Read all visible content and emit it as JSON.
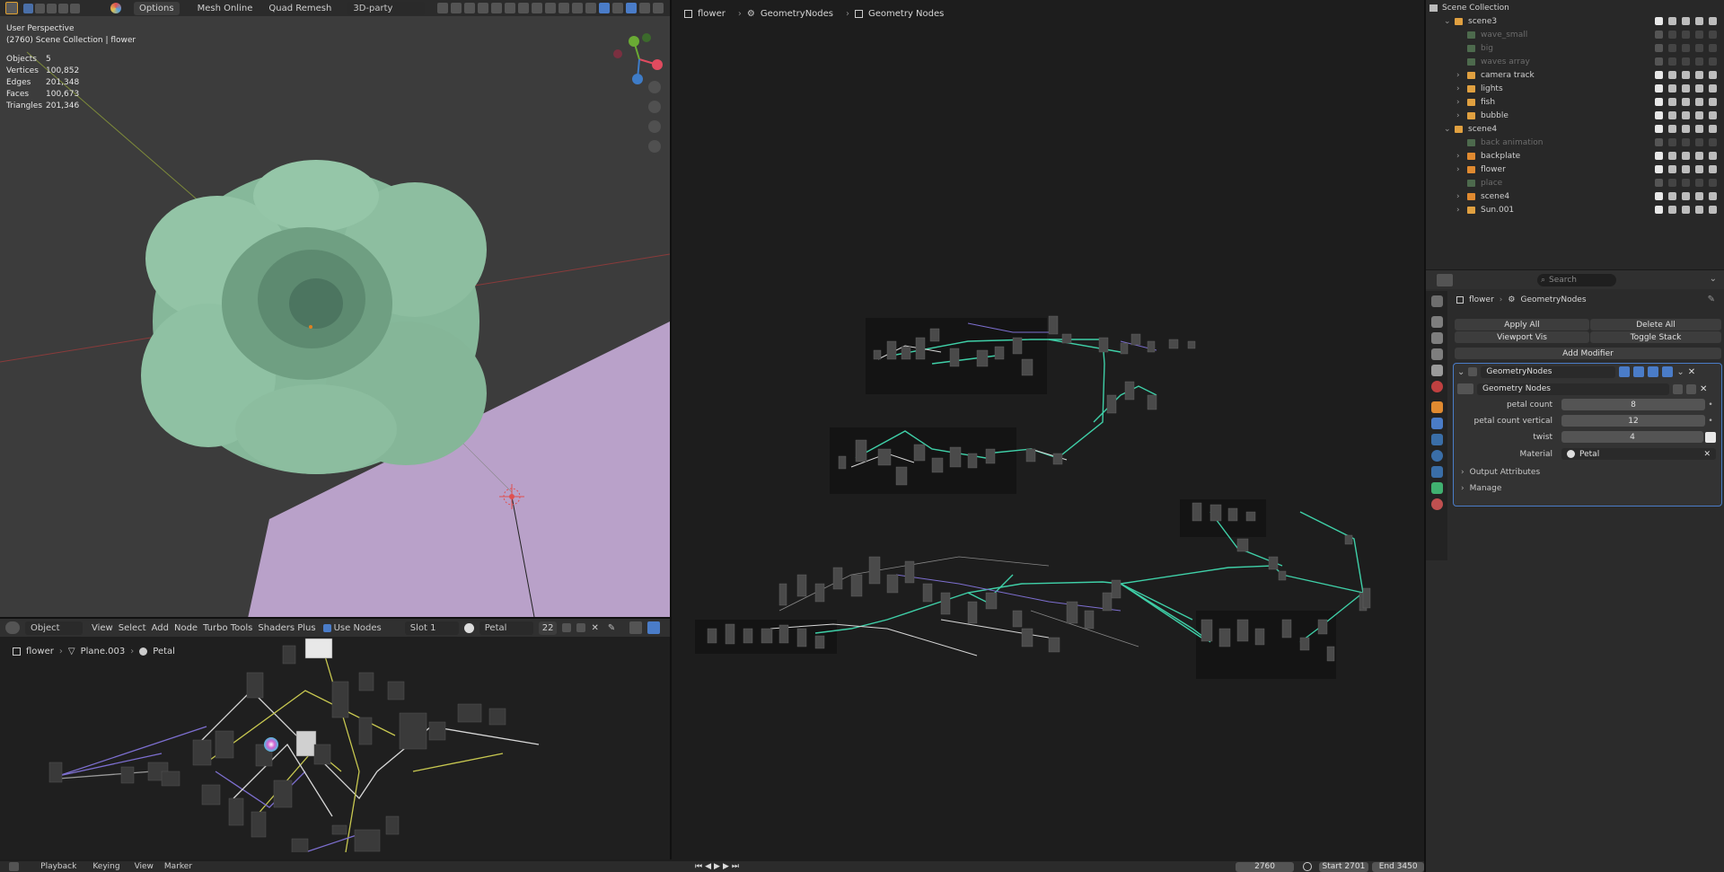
{
  "viewport": {
    "header": {
      "options_label": "Options",
      "mesh_online_label": "Mesh Online",
      "quad_remesh_label": "Quad Remesh",
      "party_dropdown": "3D-party"
    },
    "overlay": {
      "perspective": "User Perspective",
      "collection_line": "(2760) Scene Collection | flower",
      "stats": [
        {
          "label": "Objects",
          "value": "5"
        },
        {
          "label": "Vertices",
          "value": "100,852"
        },
        {
          "label": "Edges",
          "value": "201,348"
        },
        {
          "label": "Faces",
          "value": "100,673"
        },
        {
          "label": "Triangles",
          "value": "201,346"
        }
      ]
    },
    "colors": {
      "flower": "#8dbd9e",
      "plane": "#b8a0c8",
      "bg": "#3c3c3c"
    }
  },
  "shader_editor": {
    "header": {
      "mode": "Object",
      "menu": [
        "View",
        "Select",
        "Add",
        "Node",
        "Turbo Tools",
        "Shaders Plus"
      ],
      "use_nodes_label": "Use Nodes",
      "slot": "Slot 1",
      "material": "Petal",
      "users": "22"
    },
    "breadcrumb": [
      "flower",
      "Plane.003",
      "Petal"
    ]
  },
  "geo_editor": {
    "breadcrumb": [
      "flower",
      "GeometryNodes",
      "Geometry Nodes"
    ]
  },
  "timeline": {
    "menu": [
      "Playback",
      "Keying",
      "View",
      "Marker"
    ],
    "current_frame": "2760",
    "start": "Start 2701",
    "end": "End 3450"
  },
  "outliner": {
    "title": "Scene Collection",
    "rows": [
      {
        "name": "scene3",
        "indent": 1,
        "expanded": true,
        "dim": false,
        "type": "collection"
      },
      {
        "name": "wave_small",
        "indent": 2,
        "dim": true,
        "type": "mesh"
      },
      {
        "name": "big",
        "indent": 2,
        "dim": true,
        "type": "mesh"
      },
      {
        "name": "waves array",
        "indent": 2,
        "dim": true,
        "type": "mesh"
      },
      {
        "name": "camera track",
        "indent": 2,
        "dim": false,
        "type": "collection"
      },
      {
        "name": "lights",
        "indent": 2,
        "dim": false,
        "type": "collection"
      },
      {
        "name": "fish",
        "indent": 2,
        "dim": false,
        "type": "collection"
      },
      {
        "name": "bubble",
        "indent": 2,
        "dim": false,
        "type": "collection"
      },
      {
        "name": "scene4",
        "indent": 1,
        "expanded": true,
        "dim": false,
        "type": "collection"
      },
      {
        "name": "back animation",
        "indent": 2,
        "dim": true,
        "type": "mesh"
      },
      {
        "name": "backplate",
        "indent": 2,
        "dim": false,
        "type": "object"
      },
      {
        "name": "flower",
        "indent": 2,
        "dim": false,
        "type": "object"
      },
      {
        "name": "place",
        "indent": 2,
        "dim": true,
        "type": "object"
      },
      {
        "name": "scene4",
        "indent": 2,
        "dim": false,
        "type": "object"
      },
      {
        "name": "Sun.001",
        "indent": 2,
        "dim": false,
        "type": "light"
      }
    ]
  },
  "properties": {
    "search_placeholder": "Search",
    "breadcrumb": [
      "flower",
      "GeometryNodes"
    ],
    "apply_all": "Apply All",
    "delete_all": "Delete All",
    "viewport_vis": "Viewport Vis",
    "toggle_stack": "Toggle Stack",
    "add_modifier": "Add Modifier",
    "modifier_name": "GeometryNodes",
    "node_group": "Geometry Nodes",
    "inputs": [
      {
        "label": "petal count",
        "value": "8"
      },
      {
        "label": "petal count vertical",
        "value": "12"
      },
      {
        "label": "twist",
        "value": "4"
      }
    ],
    "material_label": "Material",
    "material_value": "Petal",
    "output_attributes": "Output Attributes",
    "manage": "Manage"
  }
}
